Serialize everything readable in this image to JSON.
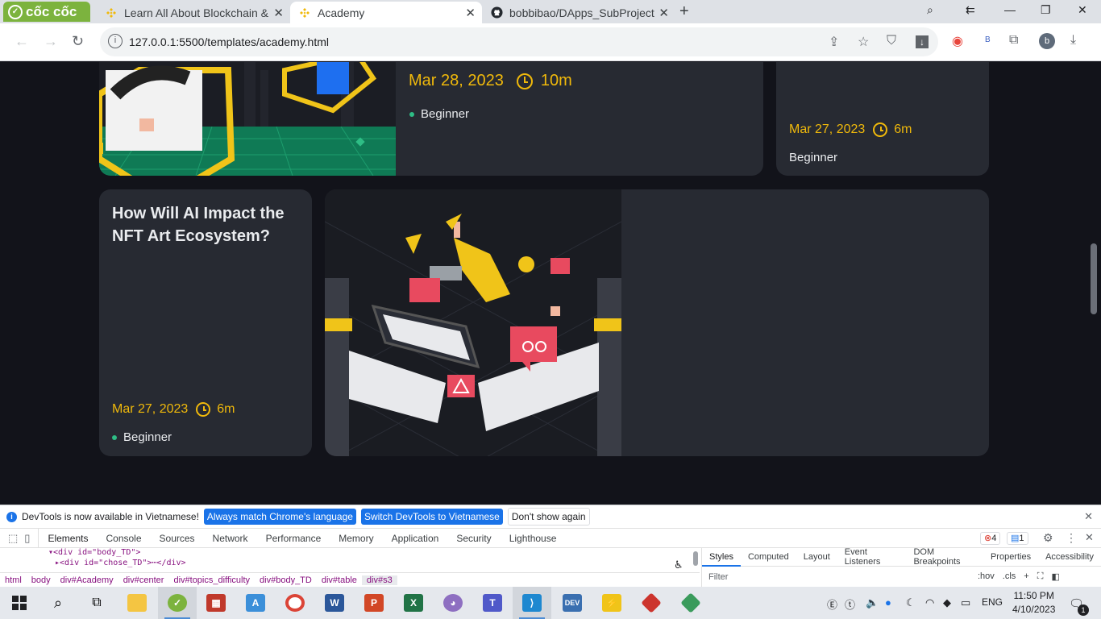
{
  "browser": {
    "brand": "cốc cốc",
    "tabs": [
      {
        "label": "Learn All About Blockchain &",
        "icon": "binance-icon"
      },
      {
        "label": "Academy",
        "icon": "binance-icon",
        "active": true
      },
      {
        "label": "bobbibao/DApps_SubProject",
        "icon": "github-icon"
      }
    ],
    "url": "127.0.0.1:5500/templates/academy.html",
    "profile_initial": "b",
    "ext_letter": "B"
  },
  "cards": {
    "top_left": {
      "date": "Mar 28, 2023",
      "duration": "10m",
      "level": "Beginner"
    },
    "top_right": {
      "date": "Mar 27, 2023",
      "duration": "6m",
      "level": "Beginner"
    },
    "bottom_left": {
      "title": "How Will AI Impact the NFT Art Ecosystem?",
      "date": "Mar 27, 2023",
      "duration": "6m",
      "level": "Beginner"
    }
  },
  "devtools": {
    "notice": "DevTools is now available in Vietnamese!",
    "btn_match": "Always match Chrome's language",
    "btn_switch": "Switch DevTools to Vietnamese",
    "btn_dismiss": "Don't show again",
    "tabs": [
      "Elements",
      "Console",
      "Sources",
      "Network",
      "Performance",
      "Memory",
      "Application",
      "Security",
      "Lighthouse"
    ],
    "error_count": "4",
    "message_count": "1",
    "code_line1": "▾<div id=\"body_TD\">",
    "code_line2": "▸<div id=\"chose_TD\">⋯</div>",
    "breadcrumbs": [
      "html",
      "body",
      "div#Academy",
      "div#center",
      "div#topics_difficulty",
      "div#body_TD",
      "div#table",
      "div#s3"
    ],
    "style_tabs": [
      "Styles",
      "Computed",
      "Layout",
      "Event Listeners",
      "DOM Breakpoints",
      "Properties",
      "Accessibility"
    ],
    "filter_placeholder": "Filter",
    "hov": ":hov",
    "cls": ".cls"
  },
  "taskbar": {
    "lang": "ENG",
    "time": "11:50 PM",
    "date": "4/10/2023",
    "notification_count": "1"
  },
  "colors": {
    "accent": "#f0b90b",
    "card_bg": "#272a32",
    "page_bg": "#12131a",
    "level_dot": "#2ebd85"
  }
}
